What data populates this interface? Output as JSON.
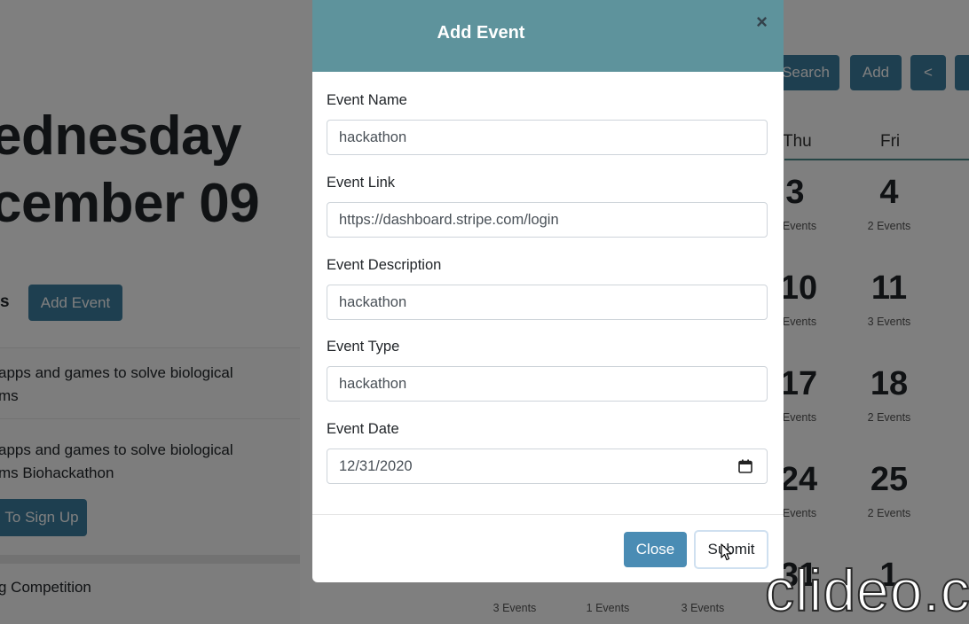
{
  "background": {
    "day_title": "ednesday",
    "date_title": "cember 09",
    "section_label": "s",
    "add_event_button": "Add Event",
    "events": [
      {
        "line1": " apps and games to solve biological",
        "line2": "ms"
      },
      {
        "line1": " apps and games to solve biological",
        "line2": "ms Biohackathon"
      }
    ],
    "signup_button": "To Sign Up",
    "last_event": "g Competition",
    "toolbar": {
      "search": "Search",
      "add": "Add",
      "prev": "<"
    },
    "calendar": {
      "headers": [
        "Thu",
        "Fri"
      ],
      "rows": [
        {
          "thu": {
            "day": "3",
            "events": "Events"
          },
          "fri": {
            "day": "4",
            "events": "2 Events"
          }
        },
        {
          "thu": {
            "day": "10",
            "events": "Events"
          },
          "fri": {
            "day": "11",
            "events": "3 Events"
          }
        },
        {
          "thu": {
            "day": "17",
            "events": "Events"
          },
          "fri": {
            "day": "18",
            "events": "2 Events"
          }
        },
        {
          "thu": {
            "day": "24",
            "events": "Events"
          },
          "fri": {
            "day": "25",
            "events": "2 Events"
          }
        },
        {
          "thu": {
            "day": "31",
            "events": "Events"
          },
          "fri": {
            "day": "1",
            "events": ""
          }
        }
      ],
      "bottom_row_events": [
        "3 Events",
        "1 Events",
        "3 Events"
      ]
    }
  },
  "modal": {
    "title": "Add Event",
    "close_symbol": "×",
    "fields": {
      "name": {
        "label": "Event Name",
        "value": "hackathon"
      },
      "link": {
        "label": "Event Link",
        "value": "https://dashboard.stripe.com/login"
      },
      "description": {
        "label": "Event Description",
        "value": "hackathon"
      },
      "type": {
        "label": "Event Type",
        "value": "hackathon"
      },
      "date": {
        "label": "Event Date",
        "value": "12/31/2020"
      }
    },
    "buttons": {
      "close": "Close",
      "submit": "Submit"
    }
  },
  "watermark": "clideo.c",
  "colors": {
    "header": "#5e939c",
    "primary": "#4a8cb4"
  },
  "icons": {
    "calendar": "calendar-icon",
    "close": "close-icon",
    "cursor": "cursor-icon"
  }
}
